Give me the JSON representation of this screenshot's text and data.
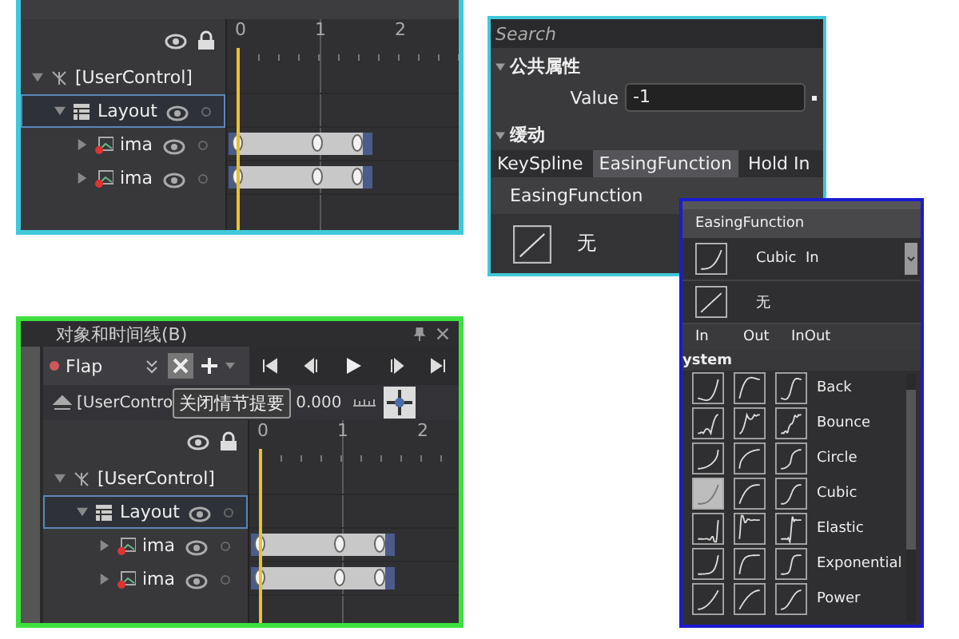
{
  "timelines": [
    {
      "kind": "plain",
      "ruler": [
        "0",
        "1",
        "2"
      ],
      "tree": [
        {
          "label": "[UserControl]",
          "kind": "control",
          "expanded": true,
          "selected": false,
          "visible": false,
          "animated": false,
          "children": [
            {
              "label": "Layout",
              "kind": "grid",
              "expanded": true,
              "selected": true,
              "visible": true,
              "animated": false,
              "children": [
                {
                  "label": "ima",
                  "kind": "image",
                  "expanded": false,
                  "selected": false,
                  "visible": true,
                  "animated": true
                },
                {
                  "label": "ima",
                  "kind": "image",
                  "expanded": false,
                  "selected": false,
                  "visible": true,
                  "animated": true
                }
              ]
            }
          ]
        }
      ]
    },
    {
      "kind": "storyboard",
      "title": "对象和时间线(B)",
      "storyboard": "Flap",
      "scope": "[UserContro",
      "time": "0.000",
      "tooltip": "关闭情节提要",
      "ruler": [
        "0",
        "1",
        "2"
      ],
      "tree": [
        {
          "label": "[UserControl]",
          "kind": "control",
          "expanded": true,
          "selected": false,
          "visible": false,
          "animated": false,
          "children": [
            {
              "label": "Layout",
              "kind": "grid",
              "expanded": true,
              "selected": true,
              "visible": true,
              "animated": false,
              "children": [
                {
                  "label": "ima",
                  "kind": "image",
                  "expanded": false,
                  "selected": false,
                  "visible": true,
                  "animated": true
                },
                {
                  "label": "ima",
                  "kind": "image",
                  "expanded": false,
                  "selected": false,
                  "visible": true,
                  "animated": true
                }
              ]
            }
          ]
        }
      ]
    }
  ],
  "properties": {
    "search": {
      "placeholder": "Search"
    },
    "common": {
      "title": "公共属性",
      "expanded": true,
      "fields": [
        {
          "label": "Value",
          "value": "-1"
        }
      ]
    },
    "easing": {
      "title": "缓动",
      "expanded": true,
      "tabs": [
        {
          "label": "KeySpline",
          "selected": false
        },
        {
          "label": "EasingFunction",
          "selected": true
        },
        {
          "label": "Hold In",
          "selected": false
        }
      ],
      "label": "EasingFunction",
      "current": {
        "label": "无",
        "kind": "linear"
      }
    }
  },
  "easing_picker": {
    "header": "EasingFunction",
    "current": {
      "label": "Cubic  In",
      "kind": "cubic"
    },
    "none": {
      "label": "无",
      "kind": "linear"
    },
    "columns": [
      "In",
      "Out",
      "InOut"
    ],
    "group": "ystem",
    "rows": [
      {
        "name": "Back",
        "kind": "back",
        "modes": [
          {
            "selected": false
          },
          {
            "selected": false
          },
          {
            "selected": false
          }
        ]
      },
      {
        "name": "Bounce",
        "kind": "bounce",
        "modes": [
          {
            "selected": false
          },
          {
            "selected": false
          },
          {
            "selected": false
          }
        ]
      },
      {
        "name": "Circle",
        "kind": "circle",
        "modes": [
          {
            "selected": false
          },
          {
            "selected": false
          },
          {
            "selected": false
          }
        ]
      },
      {
        "name": "Cubic",
        "kind": "cubic",
        "modes": [
          {
            "selected": true
          },
          {
            "selected": false
          },
          {
            "selected": false
          }
        ]
      },
      {
        "name": "Elastic",
        "kind": "elastic",
        "modes": [
          {
            "selected": false
          },
          {
            "selected": false
          },
          {
            "selected": false
          }
        ]
      },
      {
        "name": "Exponential",
        "kind": "expo",
        "modes": [
          {
            "selected": false
          },
          {
            "selected": false
          },
          {
            "selected": false
          }
        ]
      },
      {
        "name": "Power",
        "kind": "power",
        "modes": [
          {
            "selected": false
          },
          {
            "selected": false
          },
          {
            "selected": false
          }
        ]
      }
    ]
  }
}
